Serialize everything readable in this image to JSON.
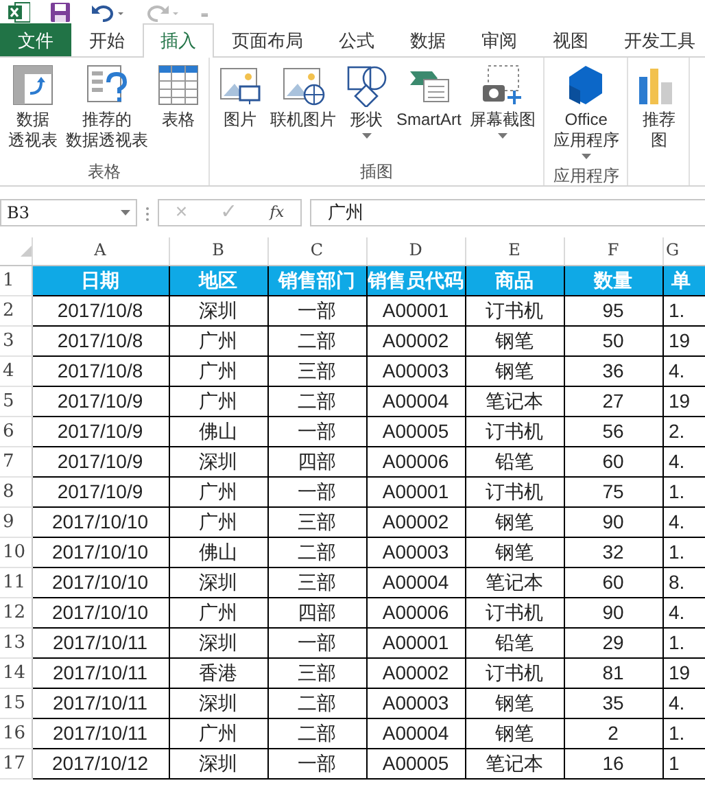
{
  "quick_access": {
    "customize": "₌"
  },
  "tabs": [
    {
      "label": "文件",
      "kind": "file",
      "selected": false
    },
    {
      "label": "开始",
      "kind": "tab",
      "selected": false
    },
    {
      "label": "插入",
      "kind": "tab",
      "selected": true
    },
    {
      "label": "页面布局",
      "kind": "tab",
      "selected": false
    },
    {
      "label": "公式",
      "kind": "tab",
      "selected": false
    },
    {
      "label": "数据",
      "kind": "tab",
      "selected": false
    },
    {
      "label": "审阅",
      "kind": "tab",
      "selected": false
    },
    {
      "label": "视图",
      "kind": "tab",
      "selected": false
    },
    {
      "label": "开发工具",
      "kind": "tab",
      "selected": false
    }
  ],
  "ribbon_groups": [
    {
      "label": "表格",
      "buttons": [
        {
          "lines": [
            "数据",
            "透视表"
          ],
          "has_menu": false
        },
        {
          "lines": [
            "推荐的",
            "数据透视表"
          ],
          "has_menu": false
        },
        {
          "lines": [
            "表格"
          ],
          "has_menu": false
        }
      ]
    },
    {
      "label": "插图",
      "buttons": [
        {
          "lines": [
            "图片"
          ],
          "has_menu": false
        },
        {
          "lines": [
            "联机图片"
          ],
          "has_menu": false
        },
        {
          "lines": [
            "形状"
          ],
          "has_menu": true
        },
        {
          "lines": [
            "SmartArt"
          ],
          "has_menu": false
        },
        {
          "lines": [
            "屏幕截图"
          ],
          "has_menu": true
        }
      ]
    },
    {
      "label": "应用程序",
      "buttons": [
        {
          "lines": [
            "Office",
            "应用程序"
          ],
          "has_menu": true
        }
      ]
    },
    {
      "buttons": [
        {
          "lines": [
            "推荐",
            "图"
          ],
          "has_menu": false
        }
      ]
    }
  ],
  "formula_bar": {
    "name_box": "B3",
    "cancel": "×",
    "enter": "✓",
    "fx": "fx",
    "value": "广州"
  },
  "sheet": {
    "columns": [
      "A",
      "B",
      "C",
      "D",
      "E",
      "F",
      "G"
    ],
    "header_row": "1",
    "headers": [
      "日期",
      "地区",
      "销售部门",
      "销售员代码",
      "商品",
      "数量",
      "单"
    ],
    "rows": [
      {
        "num": "2",
        "cells": [
          "2017/10/8",
          "深圳",
          "一部",
          "A00001",
          "订书机",
          "95",
          "1."
        ]
      },
      {
        "num": "3",
        "cells": [
          "2017/10/8",
          "广州",
          "二部",
          "A00002",
          "钢笔",
          "50",
          "19"
        ]
      },
      {
        "num": "4",
        "cells": [
          "2017/10/8",
          "广州",
          "三部",
          "A00003",
          "钢笔",
          "36",
          "4."
        ]
      },
      {
        "num": "5",
        "cells": [
          "2017/10/9",
          "广州",
          "二部",
          "A00004",
          "笔记本",
          "27",
          "19"
        ]
      },
      {
        "num": "6",
        "cells": [
          "2017/10/9",
          "佛山",
          "一部",
          "A00005",
          "订书机",
          "56",
          "2."
        ]
      },
      {
        "num": "7",
        "cells": [
          "2017/10/9",
          "深圳",
          "四部",
          "A00006",
          "铅笔",
          "60",
          "4."
        ]
      },
      {
        "num": "8",
        "cells": [
          "2017/10/9",
          "广州",
          "一部",
          "A00001",
          "订书机",
          "75",
          "1."
        ]
      },
      {
        "num": "9",
        "cells": [
          "2017/10/10",
          "广州",
          "三部",
          "A00002",
          "钢笔",
          "90",
          "4."
        ]
      },
      {
        "num": "10",
        "cells": [
          "2017/10/10",
          "佛山",
          "二部",
          "A00003",
          "钢笔",
          "32",
          "1."
        ]
      },
      {
        "num": "11",
        "cells": [
          "2017/10/10",
          "深圳",
          "三部",
          "A00004",
          "笔记本",
          "60",
          "8."
        ]
      },
      {
        "num": "12",
        "cells": [
          "2017/10/10",
          "广州",
          "四部",
          "A00006",
          "订书机",
          "90",
          "4."
        ]
      },
      {
        "num": "13",
        "cells": [
          "2017/10/11",
          "深圳",
          "一部",
          "A00001",
          "铅笔",
          "29",
          "1."
        ]
      },
      {
        "num": "14",
        "cells": [
          "2017/10/11",
          "香港",
          "三部",
          "A00002",
          "订书机",
          "81",
          "19"
        ]
      },
      {
        "num": "15",
        "cells": [
          "2017/10/11",
          "深圳",
          "二部",
          "A00003",
          "钢笔",
          "35",
          "4."
        ]
      },
      {
        "num": "16",
        "cells": [
          "2017/10/11",
          "广州",
          "二部",
          "A00004",
          "钢笔",
          "2",
          "1."
        ]
      },
      {
        "num": "17",
        "cells": [
          "2017/10/12",
          "深圳",
          "一部",
          "A00005",
          "笔记本",
          "16",
          "1"
        ]
      }
    ]
  }
}
